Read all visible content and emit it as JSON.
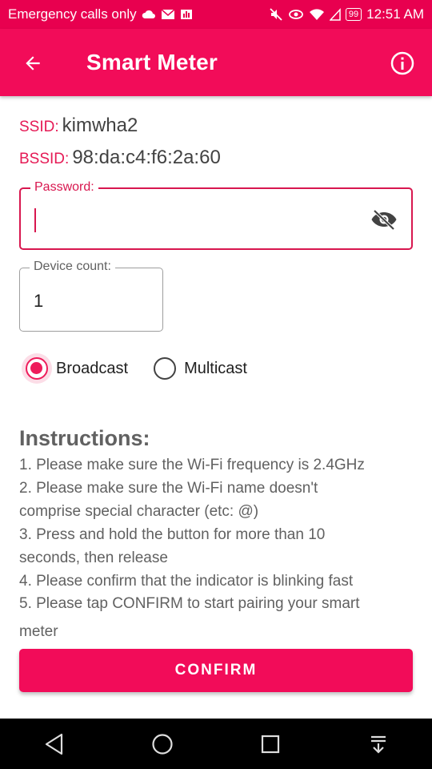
{
  "status_bar": {
    "carrier_text": "Emergency calls only",
    "battery": "99",
    "time": "12:51 AM"
  },
  "app_bar": {
    "title": "Smart Meter",
    "back_icon": "arrow-back-icon",
    "info_icon": "info-icon"
  },
  "network": {
    "ssid_label": "SSID:",
    "ssid_value": "kimwha2",
    "bssid_label": "BSSID:",
    "bssid_value": "98:da:c4:f6:2a:60"
  },
  "password": {
    "label": "Password:",
    "value": "",
    "toggle_icon": "eye-off-icon"
  },
  "device_count": {
    "label": "Device count:",
    "value": "1"
  },
  "mode": {
    "options": [
      {
        "label": "Broadcast",
        "selected": true
      },
      {
        "label": "Multicast",
        "selected": false
      }
    ]
  },
  "instructions": {
    "title": "Instructions:",
    "lines": [
      "1. Please make sure the Wi-Fi frequency is 2.4GHz",
      "2. Please make sure the Wi-Fi name doesn't",
      "comprise special character (etc: @)",
      "3. Press and hold the button for more than 10",
      "seconds, then release",
      "4. Please confirm that the indicator is blinking fast",
      "5. Please tap CONFIRM to start pairing your smart",
      "meter"
    ]
  },
  "confirm_label": "CONFIRM",
  "colors": {
    "primary": "#f20c59",
    "accent": "#d8174f"
  }
}
